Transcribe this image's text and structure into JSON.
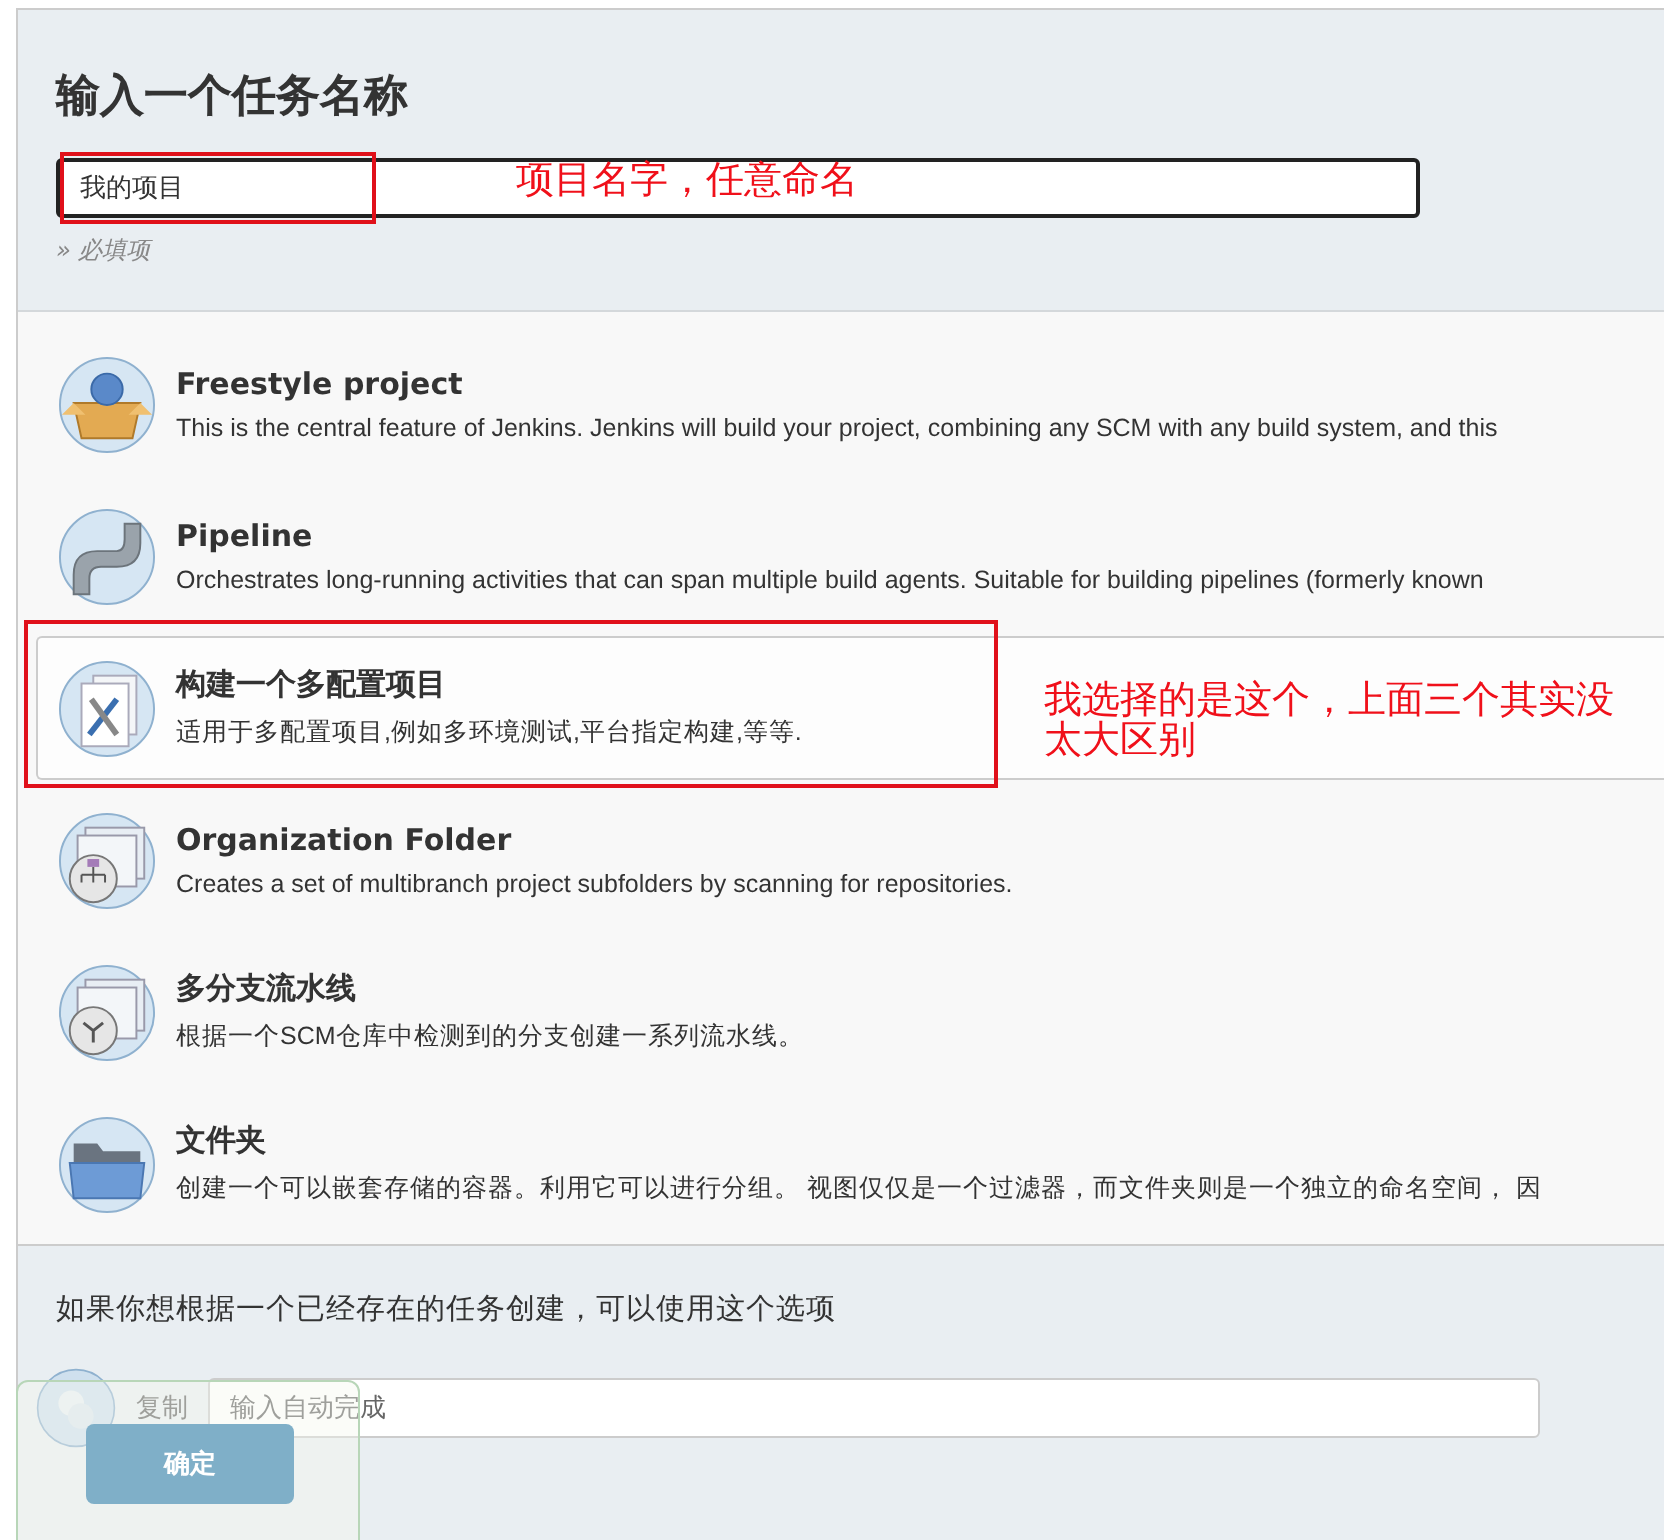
{
  "title": "输入一个任务名称",
  "name_field": {
    "value": "我的项目",
    "hint": "» 必填项"
  },
  "item_types": [
    {
      "kind": "freestyle",
      "title": "Freestyle project",
      "description": "This is the central feature of Jenkins. Jenkins will build your project, combining any SCM with any build system, and this",
      "selected": false
    },
    {
      "kind": "pipeline",
      "title": "Pipeline",
      "description": "Orchestrates long-running activities that can span multiple build agents. Suitable for building pipelines (formerly known",
      "selected": false
    },
    {
      "kind": "multiconfig",
      "title": "构建一个多配置项目",
      "description": "适用于多配置项目,例如多环境测试,平台指定构建,等等.",
      "selected": true
    },
    {
      "kind": "orgfolder",
      "title": "Organization Folder",
      "description": "Creates a set of multibranch project subfolders by scanning for repositories.",
      "selected": false
    },
    {
      "kind": "multibranch",
      "title": "多分支流水线",
      "description": "根据一个SCM仓库中检测到的分支创建一系列流水线。",
      "selected": false
    },
    {
      "kind": "folder",
      "title": "文件夹",
      "description": "创建一个可以嵌套存储的容器。利用它可以进行分组。 视图仅仅是一个过滤器，而文件夹则是一个独立的命名空间， 因",
      "selected": false
    }
  ],
  "copy_section": {
    "prompt": "如果你想根据一个已经存在的任务创建，可以使用这个选项",
    "label": "复制",
    "placeholder": "输入自动完成"
  },
  "ok_button": "确定",
  "annotations": [
    {
      "text": "项目名字，任意命名"
    },
    {
      "text": "我选择的是这个，上面三个其实没太大区别"
    }
  ]
}
